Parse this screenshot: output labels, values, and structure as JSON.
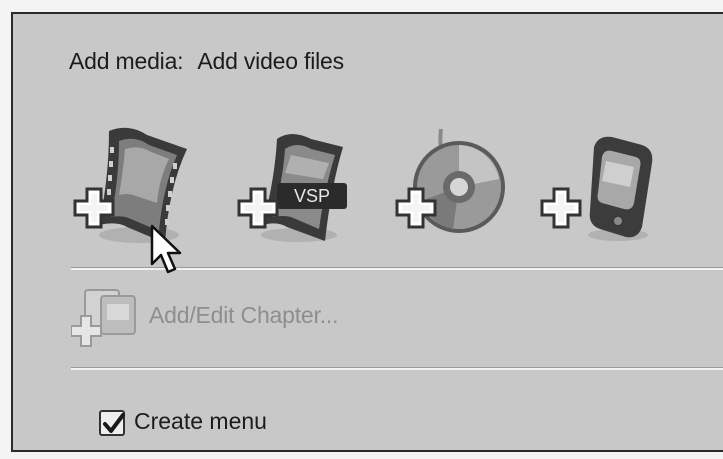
{
  "add_media": {
    "prefix": "Add media:",
    "hover_description": "Add video files"
  },
  "media_buttons": [
    {
      "icon": "film-strip-icon"
    },
    {
      "icon": "vsp-project-icon",
      "badge": "VSP"
    },
    {
      "icon": "disc-icon"
    },
    {
      "icon": "mobile-device-icon"
    }
  ],
  "chapter": {
    "label": "Add/Edit Chapter...",
    "enabled": false
  },
  "create_menu": {
    "label": "Create menu",
    "checked": true
  }
}
